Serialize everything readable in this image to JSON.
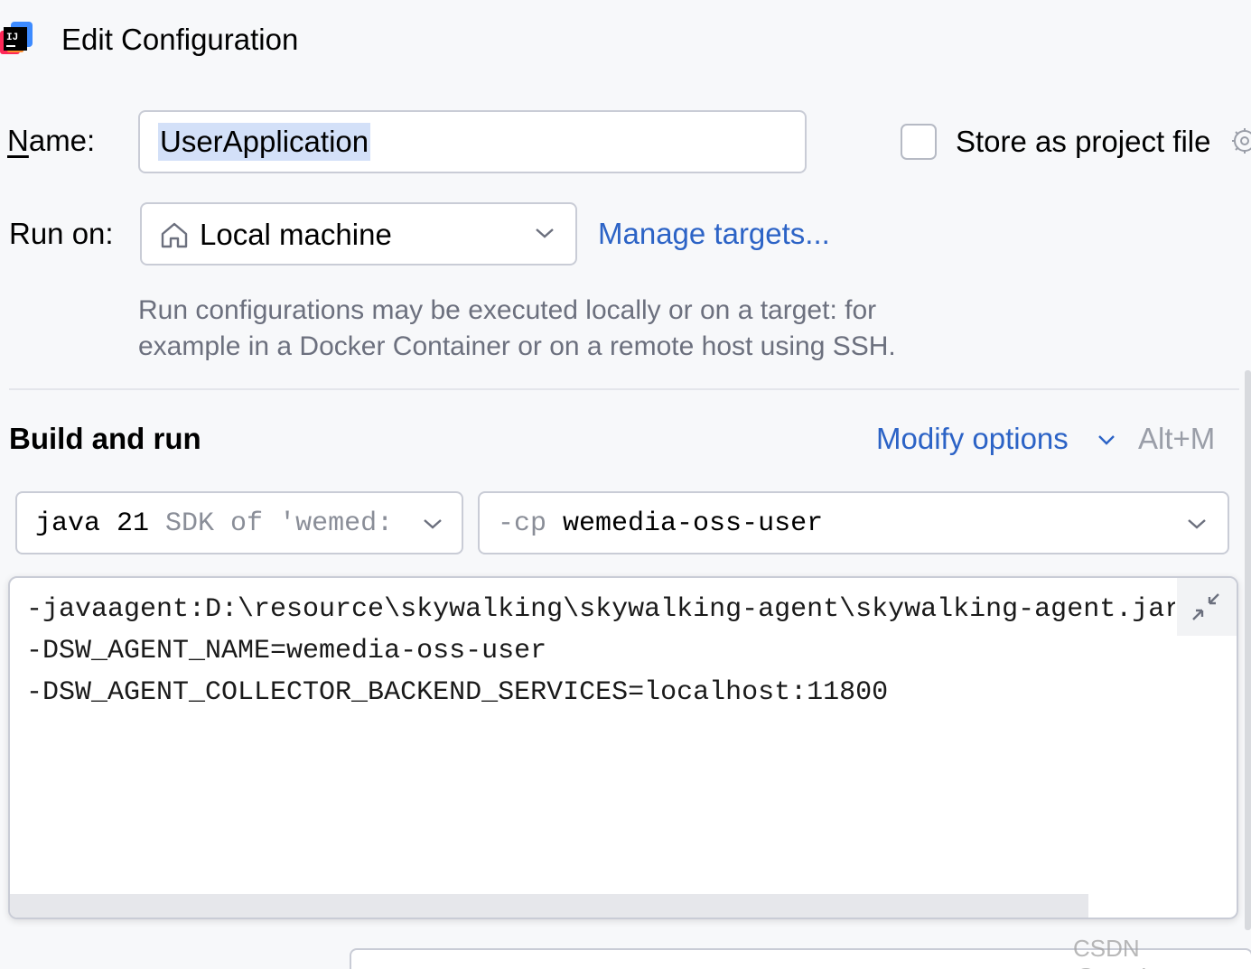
{
  "window": {
    "title": "Edit Configuration",
    "icon": "intellij-idea-icon"
  },
  "name_field": {
    "label_mnemonic": "N",
    "label_rest": "ame:",
    "value": "UserApplication"
  },
  "store_as_project_file": {
    "label": "Store as project file",
    "checked": false
  },
  "run_on": {
    "label": "Run on:",
    "selected": "Local machine",
    "icon": "home-icon",
    "manage_link": "Manage targets...",
    "hint": "Run configurations may be executed locally or on a target: for example in a Docker Container or on a remote host using SSH."
  },
  "build_and_run": {
    "title": "Build and run",
    "modify_options": "Modify options",
    "shortcut": "Alt+M",
    "sdk": {
      "main": "java 21",
      "muted": "SDK of 'wemed:"
    },
    "classpath": {
      "flag": "-cp",
      "module": "wemedia-oss-user"
    },
    "vm_options": [
      "-javaagent:D:\\resource\\skywalking\\skywalking-agent\\skywalking-agent.jar",
      "-DSW_AGENT_NAME=wemedia-oss-user",
      "-DSW_AGENT_COLLECTOR_BACKEND_SERVICES=localhost:11800"
    ]
  },
  "watermark": "CSDN @maskge",
  "colors": {
    "link": "#2c63c6",
    "selection": "#d3e0f8",
    "background": "#f7f8fa"
  }
}
